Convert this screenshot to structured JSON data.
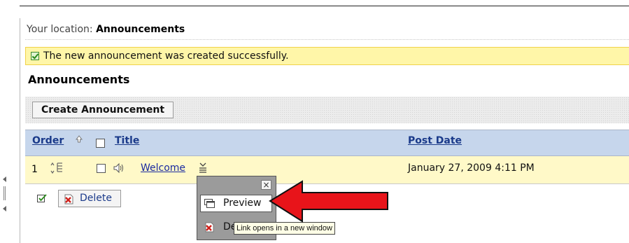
{
  "breadcrumb": {
    "prefix": "Your location:",
    "current": "Announcements"
  },
  "notification": {
    "message": "The new announcement was created successfully."
  },
  "page": {
    "title": "Announcements"
  },
  "toolbar": {
    "create_label": "Create Announcement"
  },
  "table": {
    "columns": {
      "order": "Order",
      "title": "Title",
      "post_date": "Post Date"
    },
    "rows": [
      {
        "order": "1",
        "title": "Welcome",
        "post_date": "January 27, 2009 4:11 PM"
      }
    ]
  },
  "footer": {
    "delete_label": "Delete"
  },
  "context_menu": {
    "close": "×",
    "preview_label": "Preview",
    "delete_label": "Delete",
    "tooltip": "Link opens in a new window"
  },
  "colors": {
    "header_bg": "#c6d6ec",
    "row_bg": "#fff9c8",
    "notice_bg": "#fff6a8",
    "link": "#1a2aa0",
    "arrow": "#e8141a"
  },
  "icons": {
    "success": "check-icon",
    "sort": "sort-up-icon",
    "drag": "drag-handle-icon",
    "type": "speaker-icon",
    "menu": "chevron-menu-icon",
    "select_all": "select-all-icon",
    "delete": "delete-icon",
    "preview": "preview-window-icon"
  }
}
